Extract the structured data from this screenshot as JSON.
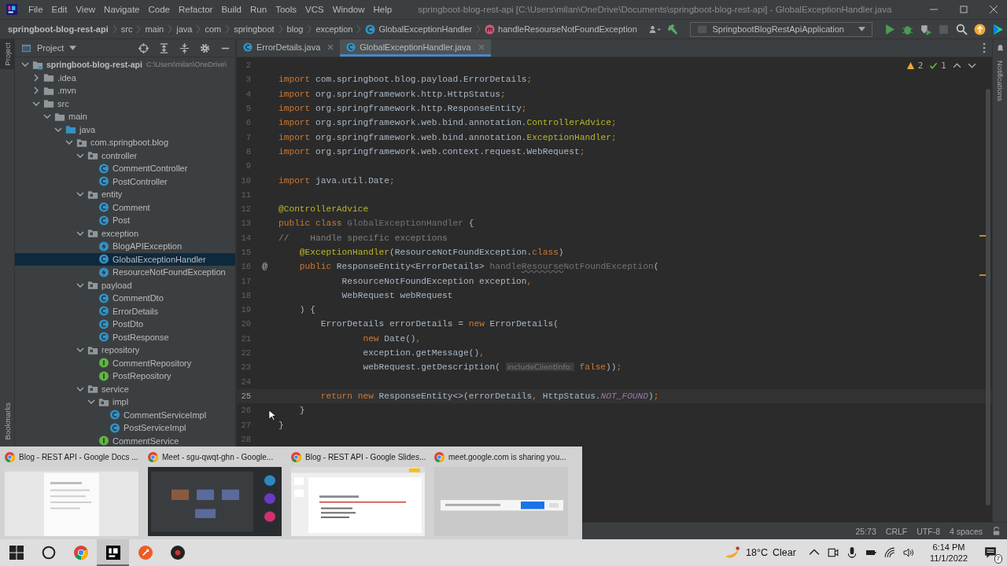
{
  "window": {
    "title": "springboot-blog-rest-api [C:\\Users\\milan\\OneDrive\\Documents\\springboot-blog-rest-api] - GlobalExceptionHandler.java"
  },
  "menu": [
    "File",
    "Edit",
    "View",
    "Navigate",
    "Code",
    "Refactor",
    "Build",
    "Run",
    "Tools",
    "VCS",
    "Window",
    "Help"
  ],
  "breadcrumbs": [
    {
      "label": "springboot-blog-rest-api",
      "kind": "project"
    },
    {
      "label": "src",
      "kind": "dir"
    },
    {
      "label": "main",
      "kind": "dir"
    },
    {
      "label": "java",
      "kind": "dir"
    },
    {
      "label": "com",
      "kind": "dir"
    },
    {
      "label": "springboot",
      "kind": "dir"
    },
    {
      "label": "blog",
      "kind": "dir"
    },
    {
      "label": "exception",
      "kind": "dir"
    },
    {
      "label": "GlobalExceptionHandler",
      "kind": "class"
    },
    {
      "label": "handleResourseNotFoundException",
      "kind": "method"
    }
  ],
  "run_config": "SpringbootBlogRestApiApplication",
  "left_stripe": {
    "top": "Project",
    "bottom": "Bookmarks"
  },
  "right_stripe": {
    "label": "Notifications"
  },
  "project_panel": {
    "title": "Project",
    "tree": [
      {
        "label": "springboot-blog-rest-api",
        "kind": "project",
        "path": "C:\\Users\\milan\\OneDrive\\",
        "expanded": true,
        "selected": false,
        "children": [
          {
            "label": ".idea",
            "kind": "folder",
            "expanded": false,
            "selected": false
          },
          {
            "label": ".mvn",
            "kind": "folder",
            "expanded": false,
            "selected": false
          },
          {
            "label": "src",
            "kind": "folder",
            "expanded": true,
            "selected": false,
            "children": [
              {
                "label": "main",
                "kind": "folder",
                "expanded": true,
                "selected": false,
                "children": [
                  {
                    "label": "java",
                    "kind": "source",
                    "expanded": true,
                    "selected": false,
                    "children": [
                      {
                        "label": "com.springboot.blog",
                        "kind": "package",
                        "expanded": true,
                        "selected": false,
                        "children": [
                          {
                            "label": "controller",
                            "kind": "package",
                            "expanded": true,
                            "selected": false,
                            "children": [
                              {
                                "label": "CommentController",
                                "kind": "class",
                                "selected": false
                              },
                              {
                                "label": "PostController",
                                "kind": "class",
                                "selected": false
                              }
                            ]
                          },
                          {
                            "label": "entity",
                            "kind": "package",
                            "expanded": true,
                            "selected": false,
                            "children": [
                              {
                                "label": "Comment",
                                "kind": "class",
                                "selected": false
                              },
                              {
                                "label": "Post",
                                "kind": "class",
                                "selected": false
                              }
                            ]
                          },
                          {
                            "label": "exception",
                            "kind": "package",
                            "expanded": true,
                            "selected": false,
                            "children": [
                              {
                                "label": "BlogAPIException",
                                "kind": "exception",
                                "selected": false
                              },
                              {
                                "label": "GlobalExceptionHandler",
                                "kind": "class",
                                "selected": true
                              },
                              {
                                "label": "ResourceNotFoundException",
                                "kind": "exception",
                                "selected": false
                              }
                            ]
                          },
                          {
                            "label": "payload",
                            "kind": "package",
                            "expanded": true,
                            "selected": false,
                            "children": [
                              {
                                "label": "CommentDto",
                                "kind": "class",
                                "selected": false
                              },
                              {
                                "label": "ErrorDetails",
                                "kind": "class",
                                "selected": false
                              },
                              {
                                "label": "PostDto",
                                "kind": "class",
                                "selected": false
                              },
                              {
                                "label": "PostResponse",
                                "kind": "class",
                                "selected": false
                              }
                            ]
                          },
                          {
                            "label": "repository",
                            "kind": "package",
                            "expanded": true,
                            "selected": false,
                            "children": [
                              {
                                "label": "CommentRepository",
                                "kind": "interface",
                                "selected": false
                              },
                              {
                                "label": "PostRepository",
                                "kind": "interface",
                                "selected": false
                              }
                            ]
                          },
                          {
                            "label": "service",
                            "kind": "package",
                            "expanded": true,
                            "selected": false,
                            "children": [
                              {
                                "label": "impl",
                                "kind": "package",
                                "expanded": true,
                                "selected": false,
                                "children": [
                                  {
                                    "label": "CommentServiceImpl",
                                    "kind": "class",
                                    "selected": false
                                  },
                                  {
                                    "label": "PostServiceImpl",
                                    "kind": "class",
                                    "selected": false
                                  }
                                ]
                              },
                              {
                                "label": "CommentService",
                                "kind": "interface",
                                "selected": false
                              }
                            ]
                          }
                        ]
                      }
                    ]
                  }
                ]
              }
            ]
          }
        ]
      }
    ]
  },
  "editor": {
    "tabs": [
      {
        "label": "ErrorDetails.java",
        "selected": false
      },
      {
        "label": "GlobalExceptionHandler.java",
        "selected": true
      }
    ],
    "inspections": {
      "warnings": "2",
      "passed": "1"
    },
    "lines": [
      {
        "n": "2",
        "current": false
      },
      {
        "n": "3",
        "current": false,
        "tokens": [
          {
            "text": "import",
            "kind": "kw"
          },
          {
            "text": " com.springboot.blog.payload.ErrorDetails",
            "kind": "text"
          },
          {
            "text": ";",
            "kind": "punct"
          }
        ]
      },
      {
        "n": "4",
        "current": false,
        "tokens": [
          {
            "text": "import",
            "kind": "kw"
          },
          {
            "text": " org.springframework.http.HttpStatus",
            "kind": "text"
          },
          {
            "text": ";",
            "kind": "punct"
          }
        ]
      },
      {
        "n": "5",
        "current": false,
        "tokens": [
          {
            "text": "import",
            "kind": "kw"
          },
          {
            "text": " org.springframework.http.ResponseEntity",
            "kind": "text"
          },
          {
            "text": ";",
            "kind": "punct"
          }
        ]
      },
      {
        "n": "6",
        "current": false,
        "tokens": [
          {
            "text": "import",
            "kind": "kw"
          },
          {
            "text": " org.springframework.web.bind.annotation.",
            "kind": "text"
          },
          {
            "text": "ControllerAdvice",
            "kind": "ann"
          },
          {
            "text": ";",
            "kind": "punct"
          }
        ]
      },
      {
        "n": "7",
        "current": false,
        "tokens": [
          {
            "text": "import",
            "kind": "kw"
          },
          {
            "text": " org.springframework.web.bind.annotation.",
            "kind": "text"
          },
          {
            "text": "ExceptionHandler",
            "kind": "ann"
          },
          {
            "text": ";",
            "kind": "punct"
          }
        ]
      },
      {
        "n": "8",
        "current": false,
        "tokens": [
          {
            "text": "import",
            "kind": "kw"
          },
          {
            "text": " org.springframework.web.context.request.WebRequest",
            "kind": "text"
          },
          {
            "text": ";",
            "kind": "punct"
          }
        ]
      },
      {
        "n": "9",
        "current": false
      },
      {
        "n": "10",
        "current": false,
        "tokens": [
          {
            "text": "import",
            "kind": "kw"
          },
          {
            "text": " java.util.Date",
            "kind": "text"
          },
          {
            "text": ";",
            "kind": "punct"
          }
        ]
      },
      {
        "n": "11",
        "current": false
      },
      {
        "n": "12",
        "current": false,
        "tokens": [
          {
            "text": "@ControllerAdvice",
            "kind": "ann"
          }
        ]
      },
      {
        "n": "13",
        "current": false,
        "tokens": [
          {
            "text": "public class ",
            "kind": "kw"
          },
          {
            "text": "GlobalExceptionHandler",
            "kind": "dim"
          },
          {
            "text": " {",
            "kind": "text"
          }
        ]
      },
      {
        "n": "14",
        "current": false,
        "tokens": [
          {
            "text": "//    Handle specific exceptions",
            "kind": "cmt"
          }
        ]
      },
      {
        "n": "15",
        "current": false,
        "tokens": [
          {
            "text": "    @ExceptionHandler",
            "kind": "ann"
          },
          {
            "text": "(ResourceNotFoundException.",
            "kind": "text"
          },
          {
            "text": "class",
            "kind": "kw"
          },
          {
            "text": ")",
            "kind": "text"
          }
        ]
      },
      {
        "n": "16",
        "current": false,
        "gutter": "@",
        "tokens": [
          {
            "text": "    public",
            "kind": "kw"
          },
          {
            "text": " ResponseEntity<ErrorDetails> ",
            "kind": "text"
          },
          {
            "text": "handle",
            "kind": "dim"
          },
          {
            "text": "Resourse",
            "kind": "typo"
          },
          {
            "text": "NotFoundException",
            "kind": "dim"
          },
          {
            "text": "(",
            "kind": "text"
          }
        ]
      },
      {
        "n": "17",
        "current": false,
        "tokens": [
          {
            "text": "            ResourceNotFoundException exception",
            "kind": "text"
          },
          {
            "text": ",",
            "kind": "punct"
          }
        ]
      },
      {
        "n": "18",
        "current": false,
        "tokens": [
          {
            "text": "            WebRequest webRequest",
            "kind": "text"
          }
        ]
      },
      {
        "n": "19",
        "current": false,
        "tokens": [
          {
            "text": "    ) {",
            "kind": "text"
          }
        ]
      },
      {
        "n": "20",
        "current": false,
        "tokens": [
          {
            "text": "        ErrorDetails errorDetails = ",
            "kind": "text"
          },
          {
            "text": "new",
            "kind": "kw"
          },
          {
            "text": " ErrorDetails(",
            "kind": "text"
          }
        ]
      },
      {
        "n": "21",
        "current": false,
        "tokens": [
          {
            "text": "                new",
            "kind": "kw"
          },
          {
            "text": " Date()",
            "kind": "text"
          },
          {
            "text": ",",
            "kind": "punct"
          }
        ]
      },
      {
        "n": "22",
        "current": false,
        "tokens": [
          {
            "text": "                exception.getMessage()",
            "kind": "text"
          },
          {
            "text": ",",
            "kind": "punct"
          }
        ]
      },
      {
        "n": "23",
        "current": false,
        "tokens": [
          {
            "text": "                webRequest.getDescription( ",
            "kind": "text"
          },
          {
            "text": "includeClientInfo:",
            "kind": "hint"
          },
          {
            "text": " false",
            "kind": "kw"
          },
          {
            "text": "))",
            "kind": "text"
          },
          {
            "text": ";",
            "kind": "punct"
          }
        ]
      },
      {
        "n": "24",
        "current": false
      },
      {
        "n": "25",
        "current": true,
        "tokens": [
          {
            "text": "        return new",
            "kind": "kw"
          },
          {
            "text": " ResponseEntity<>(errorDetails",
            "kind": "text"
          },
          {
            "text": ",",
            "kind": "punct"
          },
          {
            "text": " HttpStatus.",
            "kind": "text"
          },
          {
            "text": "NOT_FOUND",
            "kind": "const"
          },
          {
            "text": ")",
            "kind": "text"
          },
          {
            "text": ";",
            "kind": "punct"
          }
        ]
      },
      {
        "n": "26",
        "current": false,
        "tokens": [
          {
            "text": "    }",
            "kind": "text"
          }
        ]
      },
      {
        "n": "27",
        "current": false,
        "tokens": [
          {
            "text": "}",
            "kind": "text"
          }
        ]
      },
      {
        "n": "28",
        "current": false
      }
    ]
  },
  "status_bar": {
    "position": "25:73",
    "line_separator": "CRLF",
    "encoding": "UTF-8",
    "indent": "4 spaces"
  },
  "task_switcher": [
    {
      "title": "Blog - REST API - Google Docs ...",
      "kind": "picture"
    },
    {
      "title": "Meet - sgu-qwqt-ghn - Google...",
      "kind": "picture"
    },
    {
      "title": "Blog - REST API - Google Slides...",
      "kind": "picture"
    },
    {
      "title": "meet.google.com is sharing you...",
      "kind": "picture"
    }
  ],
  "taskbar": {
    "apps": [
      {
        "kind": "start",
        "selected": false
      },
      {
        "kind": "cortana",
        "selected": false
      },
      {
        "kind": "browser",
        "selected": false
      },
      {
        "kind": "ide",
        "selected": true
      },
      {
        "kind": "postman",
        "selected": false
      },
      {
        "kind": "recorder",
        "selected": false
      }
    ],
    "temperature": "18°C",
    "condition": "Clear",
    "time": "6:14 PM",
    "date": "11/1/2022",
    "notifications": "7"
  }
}
